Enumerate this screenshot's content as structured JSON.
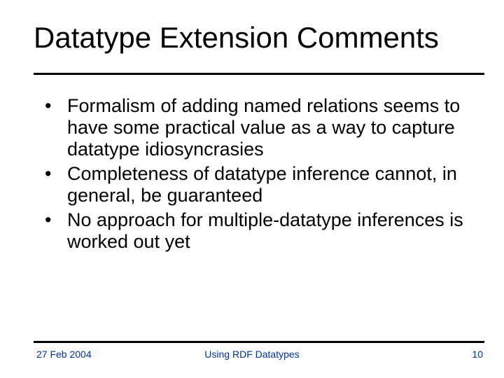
{
  "title": "Datatype Extension Comments",
  "bullets": [
    "Formalism of adding named relations seems to have some practical value as a way to capture datatype idiosyncrasies",
    "Completeness of datatype inference cannot, in general, be guaranteed",
    "No approach for multiple-datatype inferences is worked out yet"
  ],
  "footer": {
    "date": "27 Feb 2004",
    "center": "Using RDF Datatypes",
    "page": "10"
  }
}
